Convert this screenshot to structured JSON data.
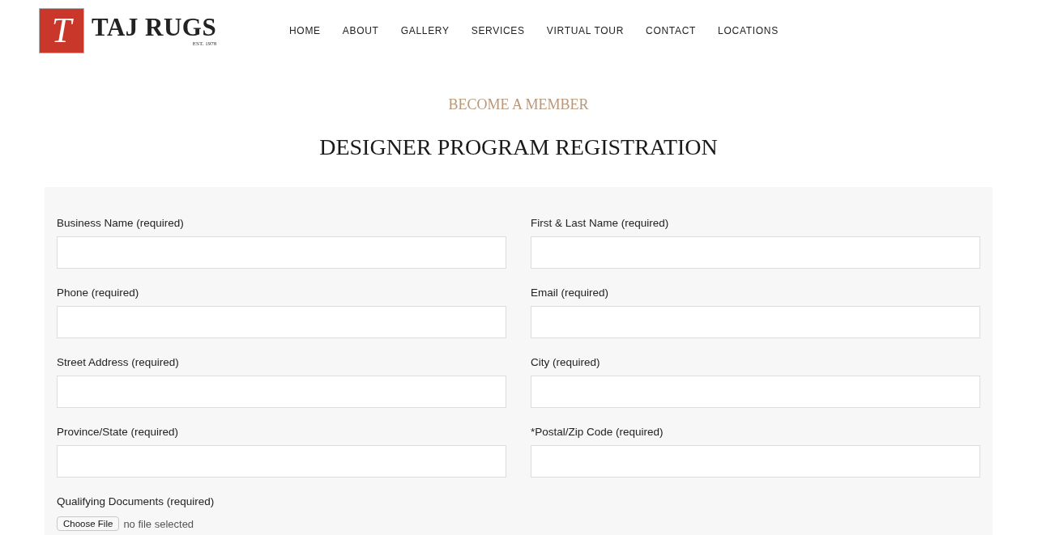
{
  "header": {
    "logo": {
      "monogram": "T",
      "name": "TAJ RUGS",
      "tagline": "EST. 1978"
    },
    "nav": [
      "HOME",
      "ABOUT",
      "GALLERY",
      "SERVICES",
      "VIRTUAL TOUR",
      "CONTACT",
      "LOCATIONS"
    ]
  },
  "intro": {
    "kicker": "BECOME A MEMBER",
    "title": "DESIGNER PROGRAM REGISTRATION"
  },
  "form": {
    "fields": [
      {
        "kind": "text",
        "label": "Business Name (required)"
      },
      {
        "kind": "text",
        "label": "First & Last Name (required)"
      },
      {
        "kind": "text",
        "label": "Phone (required)"
      },
      {
        "kind": "text",
        "label": "Email (required)"
      },
      {
        "kind": "text",
        "label": "Street Address (required)"
      },
      {
        "kind": "text",
        "label": "City (required)"
      },
      {
        "kind": "text",
        "label": "Province/State (required)"
      },
      {
        "kind": "text",
        "label": "*Postal/Zip Code (required)"
      },
      {
        "kind": "file",
        "label": "Qualifying Documents (required)",
        "button": "Choose File",
        "status": "no file selected"
      }
    ]
  }
}
